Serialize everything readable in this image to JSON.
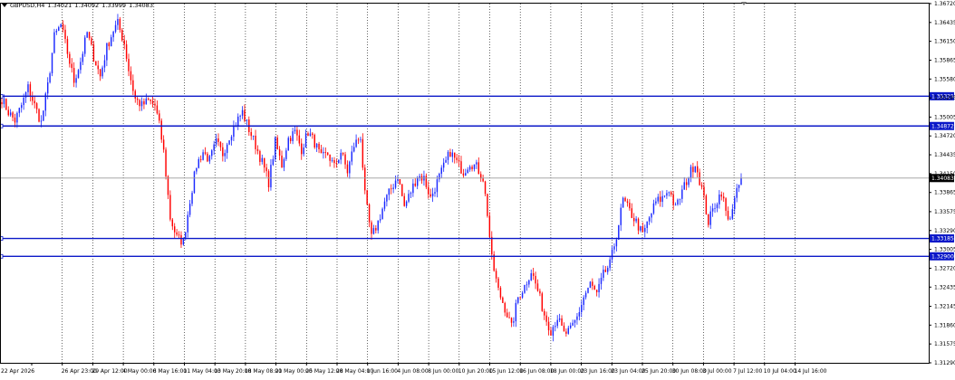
{
  "header": {
    "symbol": "GBPUSD,H4",
    "ohlc": [
      "1.34021",
      "1.34092",
      "1.33999",
      "1.34083"
    ]
  },
  "colors": {
    "background": "#ffffff",
    "grid": "#000000",
    "bull": "#1a28ff",
    "bear": "#ff0000",
    "level": "#0b18c8",
    "current_price_line": "#9a9a9a",
    "current_price_tag": "#000000"
  },
  "price_axis": {
    "min": 1.3129,
    "max": 1.3672,
    "labels": [
      "1.36720",
      "1.36435",
      "1.36150",
      "1.35865",
      "1.35580",
      "1.35295",
      "1.35005",
      "1.34720",
      "1.34435",
      "1.34150",
      "1.33865",
      "1.33575",
      "1.33290",
      "1.33005",
      "1.32720",
      "1.32435",
      "1.32145",
      "1.31860",
      "1.31575",
      "1.31290"
    ]
  },
  "time_axis": {
    "labels": [
      "22 Apr 2026",
      "26 Apr 23:00",
      "29 Apr 12:00",
      "4 May 00:00",
      "6 May 16:00",
      "11 May 04:00",
      "13 May 20:00",
      "18 May 08:00",
      "21 May 00:00",
      "25 May 12:00",
      "28 May 04:00",
      "1 Jun 16:00",
      "4 Jun 08:00",
      "8 Jun 00:00",
      "10 Jun 20:00",
      "15 Jun 12:00",
      "16 Jun 08:00",
      "18 Jun 00:00",
      "23 Jun 16:00",
      "23 Jun 04:00",
      "25 Jun 20:00",
      "30 Jun 08:00",
      "3 Jul 00:00",
      "7 Jul 12:00",
      "10 Jul 04:00",
      "14 Jul 16:00"
    ]
  },
  "levels": [
    {
      "price": 1.3532,
      "label": "1.35325"
    },
    {
      "price": 1.3487,
      "label": "1.34872"
    },
    {
      "price": 1.3317,
      "label": "1.33185"
    },
    {
      "price": 1.329,
      "label": "1.32900"
    }
  ],
  "current_price": {
    "price": 1.34083,
    "label": "1.34083"
  },
  "chart_data": {
    "type": "candlestick",
    "title": "",
    "xlabel": "",
    "ylabel": "",
    "ylim": [
      1.3129,
      1.3672
    ],
    "grid": true,
    "anchors": [
      [
        0,
        1.3528
      ],
      [
        3,
        1.3508
      ],
      [
        6,
        1.3495
      ],
      [
        9,
        1.3518
      ],
      [
        12,
        1.3545
      ],
      [
        15,
        1.3518
      ],
      [
        18,
        1.3492
      ],
      [
        21,
        1.3548
      ],
      [
        24,
        1.3622
      ],
      [
        27,
        1.364
      ],
      [
        30,
        1.3598
      ],
      [
        33,
        1.3555
      ],
      [
        36,
        1.3585
      ],
      [
        39,
        1.3628
      ],
      [
        42,
        1.3592
      ],
      [
        45,
        1.3562
      ],
      [
        48,
        1.3606
      ],
      [
        51,
        1.3632
      ],
      [
        53,
        1.3642
      ],
      [
        56,
        1.3612
      ],
      [
        58,
        1.3572
      ],
      [
        61,
        1.3528
      ],
      [
        64,
        1.3518
      ],
      [
        67,
        1.3525
      ],
      [
        70,
        1.3518
      ],
      [
        72,
        1.3488
      ],
      [
        74,
        1.3448
      ],
      [
        77,
        1.3348
      ],
      [
        80,
        1.3318
      ],
      [
        83,
        1.3312
      ],
      [
        86,
        1.3375
      ],
      [
        89,
        1.3428
      ],
      [
        92,
        1.3448
      ],
      [
        95,
        1.3435
      ],
      [
        98,
        1.3462
      ],
      [
        101,
        1.3445
      ],
      [
        104,
        1.3472
      ],
      [
        107,
        1.3492
      ],
      [
        110,
        1.3508
      ],
      [
        113,
        1.3482
      ],
      [
        116,
        1.3458
      ],
      [
        119,
        1.3432
      ],
      [
        122,
        1.3402
      ],
      [
        125,
        1.3462
      ],
      [
        128,
        1.3428
      ],
      [
        131,
        1.3468
      ],
      [
        134,
        1.3478
      ],
      [
        137,
        1.3452
      ],
      [
        140,
        1.3478
      ],
      [
        143,
        1.3462
      ],
      [
        146,
        1.3438
      ],
      [
        149,
        1.3445
      ],
      [
        152,
        1.3425
      ],
      [
        155,
        1.3448
      ],
      [
        158,
        1.3418
      ],
      [
        161,
        1.3458
      ],
      [
        164,
        1.3472
      ],
      [
        166,
        1.3382
      ],
      [
        169,
        1.3318
      ],
      [
        172,
        1.3342
      ],
      [
        175,
        1.3372
      ],
      [
        178,
        1.3392
      ],
      [
        181,
        1.3412
      ],
      [
        184,
        1.3365
      ],
      [
        187,
        1.3388
      ],
      [
        190,
        1.3412
      ],
      [
        193,
        1.3408
      ],
      [
        196,
        1.3378
      ],
      [
        199,
        1.3402
      ],
      [
        202,
        1.3425
      ],
      [
        205,
        1.3448
      ],
      [
        208,
        1.3432
      ],
      [
        211,
        1.3418
      ],
      [
        214,
        1.3432
      ],
      [
        217,
        1.3425
      ],
      [
        220,
        1.3408
      ],
      [
        222,
        1.3355
      ],
      [
        224,
        1.3285
      ],
      [
        227,
        1.3238
      ],
      [
        230,
        1.3212
      ],
      [
        233,
        1.3182
      ],
      [
        236,
        1.3228
      ],
      [
        239,
        1.3245
      ],
      [
        242,
        1.3268
      ],
      [
        245,
        1.3238
      ],
      [
        248,
        1.3202
      ],
      [
        251,
        1.3178
      ],
      [
        254,
        1.3198
      ],
      [
        257,
        1.3172
      ],
      [
        260,
        1.3178
      ],
      [
        263,
        1.3198
      ],
      [
        266,
        1.3228
      ],
      [
        269,
        1.3248
      ],
      [
        272,
        1.3232
      ],
      [
        275,
        1.3262
      ],
      [
        278,
        1.3278
      ],
      [
        281,
        1.3322
      ],
      [
        284,
        1.3375
      ],
      [
        287,
        1.3358
      ],
      [
        290,
        1.3342
      ],
      [
        293,
        1.3322
      ],
      [
        296,
        1.3348
      ],
      [
        299,
        1.3372
      ],
      [
        302,
        1.3378
      ],
      [
        305,
        1.3392
      ],
      [
        308,
        1.3362
      ],
      [
        311,
        1.3388
      ],
      [
        314,
        1.3412
      ],
      [
        317,
        1.3432
      ],
      [
        320,
        1.3392
      ],
      [
        323,
        1.3342
      ],
      [
        326,
        1.3368
      ],
      [
        329,
        1.3388
      ],
      [
        332,
        1.3342
      ],
      [
        335,
        1.3375
      ],
      [
        338,
        1.3408
      ]
    ],
    "bar_count": 339
  }
}
